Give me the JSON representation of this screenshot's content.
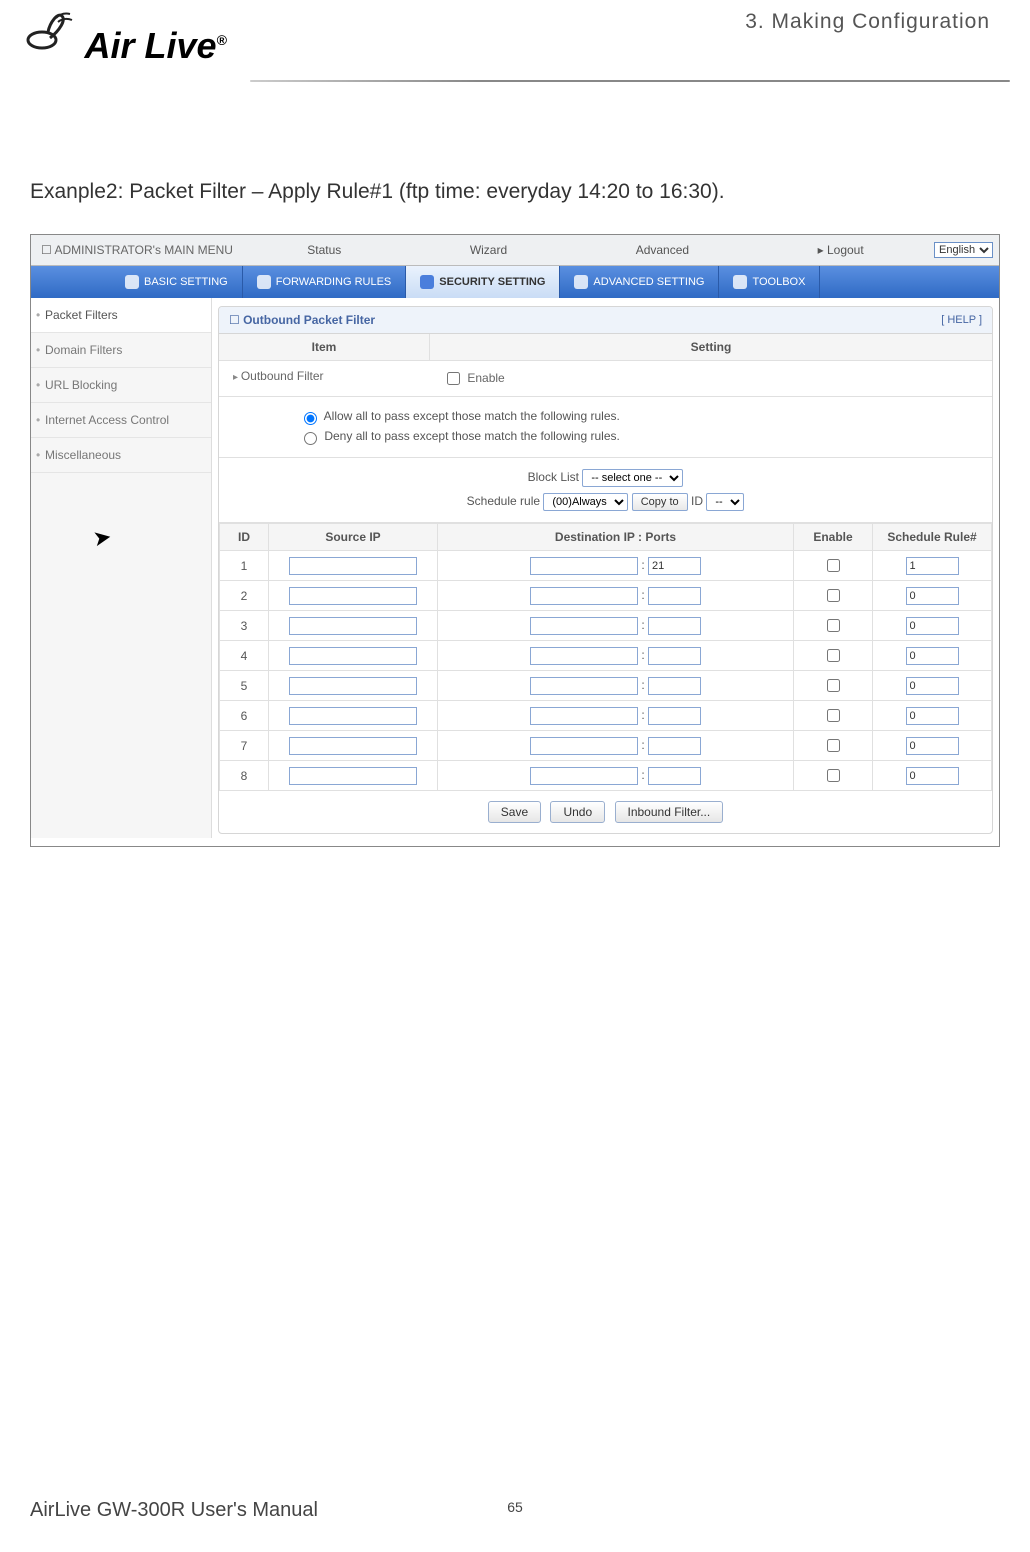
{
  "doc": {
    "chapter": "3. Making Configuration",
    "brand": "Air Live",
    "brand_mark": "®",
    "example_text": "Exanple2: Packet Filter – Apply Rule#1 (ftp time: everyday 14:20 to 16:30).",
    "footer_left": "AirLive GW-300R User's Manual",
    "page_number": "65"
  },
  "topbar": {
    "admin_label": "ADMINISTRATOR's MAIN MENU",
    "nav": [
      "Status",
      "Wizard",
      "Advanced",
      "▸ Logout"
    ],
    "language": "English"
  },
  "tabs": [
    {
      "label": "BASIC SETTING",
      "active": false
    },
    {
      "label": "FORWARDING RULES",
      "active": false
    },
    {
      "label": "SECURITY SETTING",
      "active": true
    },
    {
      "label": "ADVANCED SETTING",
      "active": false
    },
    {
      "label": "TOOLBOX",
      "active": false
    }
  ],
  "sidebar": {
    "items": [
      {
        "label": "Packet Filters",
        "active": true
      },
      {
        "label": "Domain Filters",
        "active": false
      },
      {
        "label": "URL Blocking",
        "active": false
      },
      {
        "label": "Internet Access Control",
        "active": false
      },
      {
        "label": "Miscellaneous",
        "active": false
      }
    ]
  },
  "panel": {
    "title": "Outbound Packet Filter",
    "help": "[ HELP ]",
    "columns2": {
      "item": "Item",
      "setting": "Setting"
    },
    "outbound_label": "Outbound Filter",
    "enable_label": "Enable",
    "radio_allow": "Allow all to pass except those match the following rules.",
    "radio_deny": "Deny all to pass except those match the following rules.",
    "block_list_label": "Block List",
    "block_list_value": "-- select one --",
    "schedule_rule_label": "Schedule rule",
    "schedule_rule_value": "(00)Always",
    "copy_to_label": "Copy to",
    "id_label": "ID",
    "id_select_value": "--"
  },
  "rules_header": {
    "id": "ID",
    "src": "Source IP",
    "dst": "Destination IP : Ports",
    "enable": "Enable",
    "sched": "Schedule Rule#"
  },
  "rules": [
    {
      "id": "1",
      "src": "",
      "dst_ip": "",
      "dst_port": "21",
      "enable": false,
      "sched": "1"
    },
    {
      "id": "2",
      "src": "",
      "dst_ip": "",
      "dst_port": "",
      "enable": false,
      "sched": "0"
    },
    {
      "id": "3",
      "src": "",
      "dst_ip": "",
      "dst_port": "",
      "enable": false,
      "sched": "0"
    },
    {
      "id": "4",
      "src": "",
      "dst_ip": "",
      "dst_port": "",
      "enable": false,
      "sched": "0"
    },
    {
      "id": "5",
      "src": "",
      "dst_ip": "",
      "dst_port": "",
      "enable": false,
      "sched": "0"
    },
    {
      "id": "6",
      "src": "",
      "dst_ip": "",
      "dst_port": "",
      "enable": false,
      "sched": "0"
    },
    {
      "id": "7",
      "src": "",
      "dst_ip": "",
      "dst_port": "",
      "enable": false,
      "sched": "0"
    },
    {
      "id": "8",
      "src": "",
      "dst_ip": "",
      "dst_port": "",
      "enable": false,
      "sched": "0"
    }
  ],
  "actions": {
    "save": "Save",
    "undo": "Undo",
    "inbound": "Inbound Filter..."
  }
}
